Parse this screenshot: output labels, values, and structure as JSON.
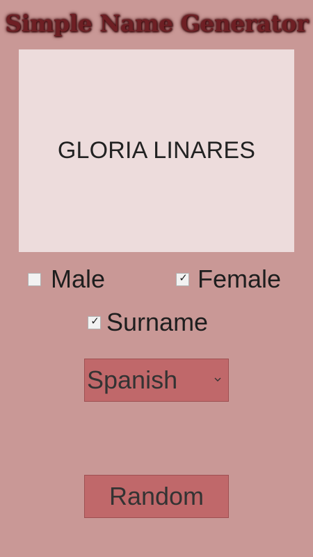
{
  "app": {
    "title": "Simple Name Generator"
  },
  "result": {
    "name": "GLORIA LINARES"
  },
  "options": {
    "male": {
      "label": "Male",
      "checked": false
    },
    "female": {
      "label": "Female",
      "checked": true
    },
    "surname": {
      "label": "Surname",
      "checked": true
    }
  },
  "language": {
    "selected": "Spanish"
  },
  "actions": {
    "random_label": "Random"
  },
  "icons": {
    "check": "check-icon",
    "dropdown": "chevron-down-icon"
  },
  "colors": {
    "background": "#c99896",
    "panel": "#eddcdc",
    "button": "#c0686a",
    "title": "#6e1f24"
  }
}
